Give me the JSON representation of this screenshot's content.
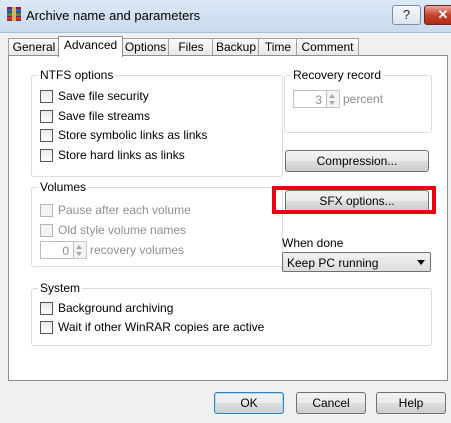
{
  "window": {
    "title": "Archive name and parameters",
    "help_label": "?",
    "close_label": "✕"
  },
  "tabs": [
    {
      "label": "General",
      "active": false
    },
    {
      "label": "Advanced",
      "active": true
    },
    {
      "label": "Options",
      "active": false
    },
    {
      "label": "Files",
      "active": false
    },
    {
      "label": "Backup",
      "active": false
    },
    {
      "label": "Time",
      "active": false
    },
    {
      "label": "Comment",
      "active": false
    }
  ],
  "ntfs": {
    "title": "NTFS options",
    "items": [
      {
        "label": "Save file security",
        "checked": false
      },
      {
        "label": "Save file streams",
        "checked": false
      },
      {
        "label": "Store symbolic links as links",
        "checked": false
      },
      {
        "label": "Store hard links as links",
        "checked": false
      }
    ]
  },
  "recovery": {
    "title": "Recovery record",
    "value": "3",
    "unit": "percent"
  },
  "compression_button": "Compression...",
  "sfx_button": "SFX options...",
  "volumes": {
    "title": "Volumes",
    "pause": "Pause after each volume",
    "old_style": "Old style volume names",
    "recovery_value": "0",
    "recovery_unit": "recovery volumes"
  },
  "when_done": {
    "label": "When done",
    "selected": "Keep PC running"
  },
  "system": {
    "title": "System",
    "items": [
      {
        "label": "Background archiving",
        "checked": false
      },
      {
        "label": "Wait if other WinRAR copies are active",
        "checked": false
      }
    ]
  },
  "buttons": {
    "ok": "OK",
    "cancel": "Cancel",
    "help": "Help"
  },
  "colors": {
    "highlight": "#e60012"
  }
}
